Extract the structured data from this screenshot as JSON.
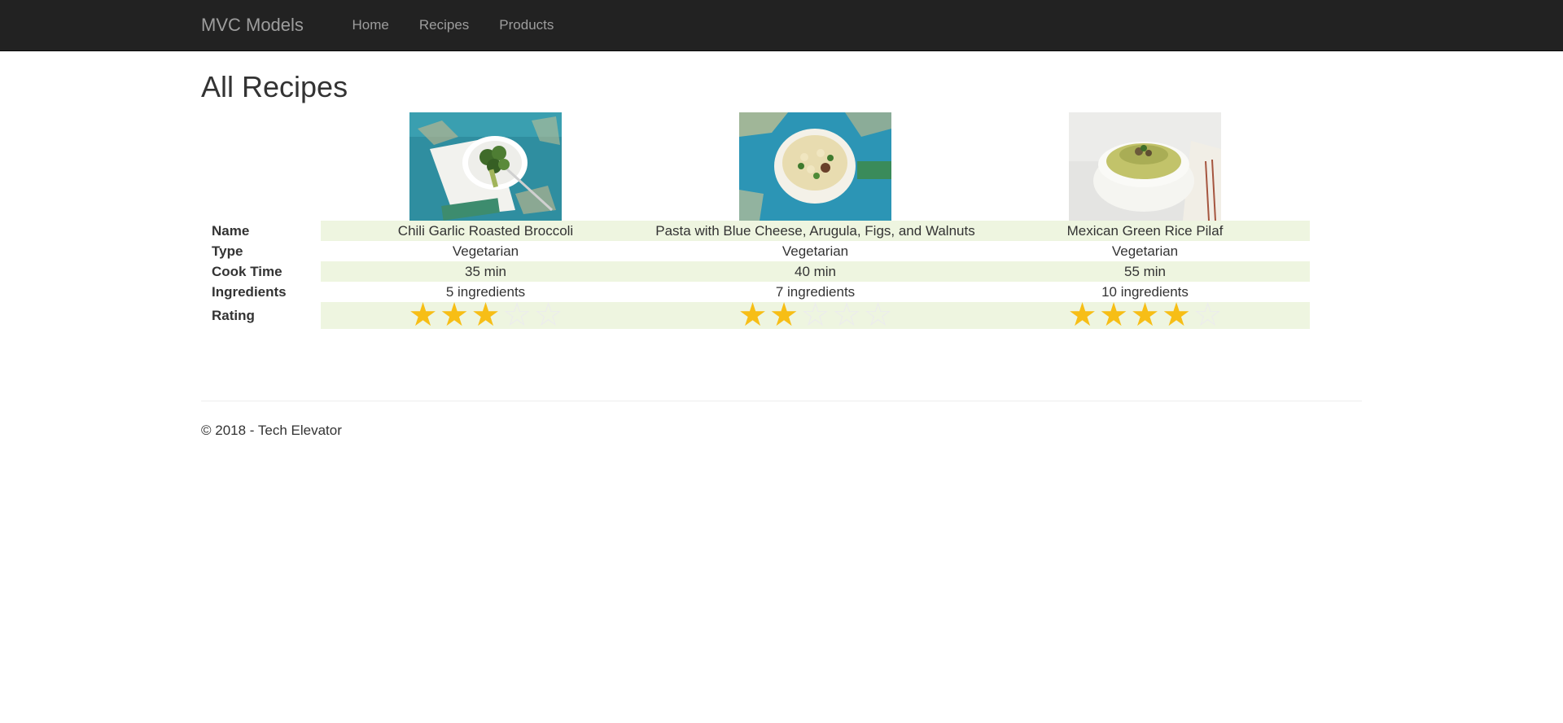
{
  "nav": {
    "brand": "MVC Models",
    "links": [
      "Home",
      "Recipes",
      "Products"
    ]
  },
  "page_title": "All Recipes",
  "row_labels": {
    "name": "Name",
    "type": "Type",
    "cook_time": "Cook Time",
    "ingredients": "Ingredients",
    "rating": "Rating"
  },
  "recipes": [
    {
      "name": "Chili Garlic Roasted Broccoli",
      "type": "Vegetarian",
      "cook_time": "35 min",
      "ingredients": "5 ingredients",
      "rating": 3,
      "rating_max": 5,
      "image": "broccoli-dish-image"
    },
    {
      "name": "Pasta with Blue Cheese, Arugula, Figs, and Walnuts",
      "type": "Vegetarian",
      "cook_time": "40 min",
      "ingredients": "7 ingredients",
      "rating": 2,
      "rating_max": 5,
      "image": "pasta-bowl-image"
    },
    {
      "name": "Mexican Green Rice Pilaf",
      "type": "Vegetarian",
      "cook_time": "55 min",
      "ingredients": "10 ingredients",
      "rating": 4,
      "rating_max": 5,
      "image": "rice-pilaf-image"
    }
  ],
  "colors": {
    "navbar": "#222222",
    "nav_text": "#9d9d9d",
    "band": "#eef5e0",
    "star_full": "#f7be16",
    "star_empty": "#ececec"
  },
  "footer": "© 2018 - Tech Elevator"
}
